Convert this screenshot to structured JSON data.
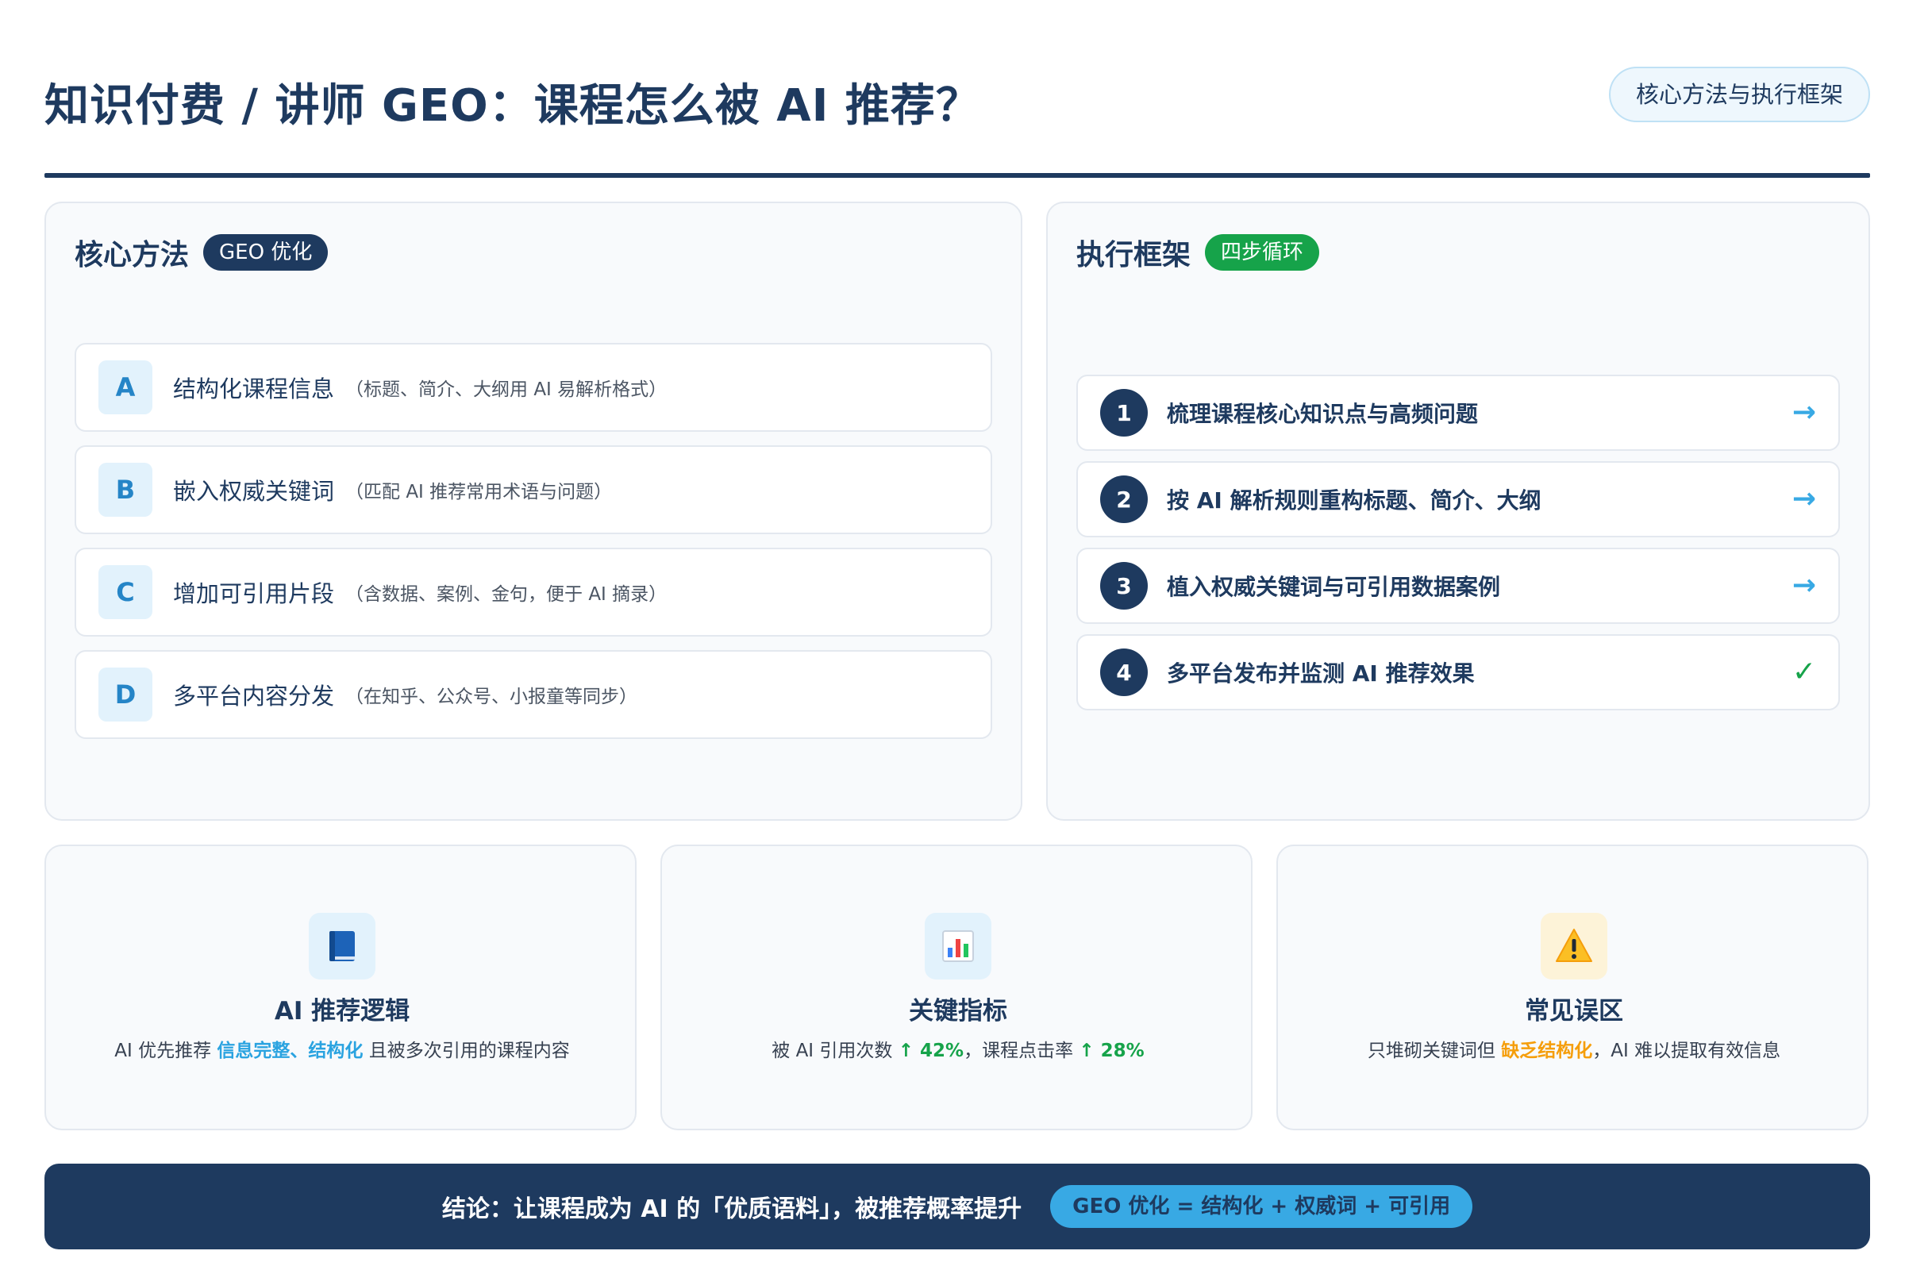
{
  "header": {
    "title": "知识付费 / 讲师 GEO：课程怎么被 AI 推荐？",
    "badge": "核心方法与执行框架"
  },
  "methods_panel": {
    "title": "核心方法",
    "tag": "GEO 优化",
    "items": [
      {
        "letter": "A",
        "name": "结构化课程信息",
        "note": "（标题、简介、大纲用 AI 易解析格式）"
      },
      {
        "letter": "B",
        "name": "嵌入权威关键词",
        "note": "（匹配 AI 推荐常用术语与问题）"
      },
      {
        "letter": "C",
        "name": "增加可引用片段",
        "note": "（含数据、案例、金句，便于 AI 摘录）"
      },
      {
        "letter": "D",
        "name": "多平台内容分发",
        "note": "（在知乎、公众号、小报童等同步）"
      }
    ]
  },
  "steps_panel": {
    "title": "执行框架",
    "tag": "四步循环",
    "steps": [
      {
        "num": "1",
        "text": "梳理课程核心知识点与高频问题",
        "end": "→",
        "end_icon": "arrow-right-icon"
      },
      {
        "num": "2",
        "text": "按 AI 解析规则重构标题、简介、大纲",
        "end": "→",
        "end_icon": "arrow-right-icon"
      },
      {
        "num": "3",
        "text": "植入权威关键词与可引用数据案例",
        "end": "→",
        "end_icon": "arrow-right-icon"
      },
      {
        "num": "4",
        "text": "多平台发布并监测 AI 推荐效果",
        "end": "✓",
        "end_icon": "check-icon"
      }
    ]
  },
  "cards": [
    {
      "icon": "book-icon",
      "title": "AI 推荐逻辑",
      "desc_pre": "AI 优先推荐 ",
      "desc_hl": "信息完整、结构化",
      "desc_post": " 且被多次引用的课程内容"
    },
    {
      "icon": "bar-chart-icon",
      "title": "关键指标",
      "desc_a": "被 AI 引用次数 ",
      "desc_a_val": "↑ 42%",
      "desc_b": "，课程点击率 ",
      "desc_b_val": "↑ 28%"
    },
    {
      "icon": "warning-icon",
      "title": "常见误区",
      "desc_pre": "只堆砌关键词但 ",
      "desc_hl": "缺乏结构化",
      "desc_post": "，AI 难以提取有效信息"
    }
  ],
  "conclusion": {
    "text": "结论：让课程成为 AI 的「优质语料」，被推荐概率提升",
    "formula": "GEO 优化 = 结构化 + 权威词 + 可引用"
  },
  "colors": {
    "navy": "#1e3a5f",
    "accent_blue": "#38a9e4",
    "green": "#16a34a",
    "orange": "#f59e0b"
  }
}
